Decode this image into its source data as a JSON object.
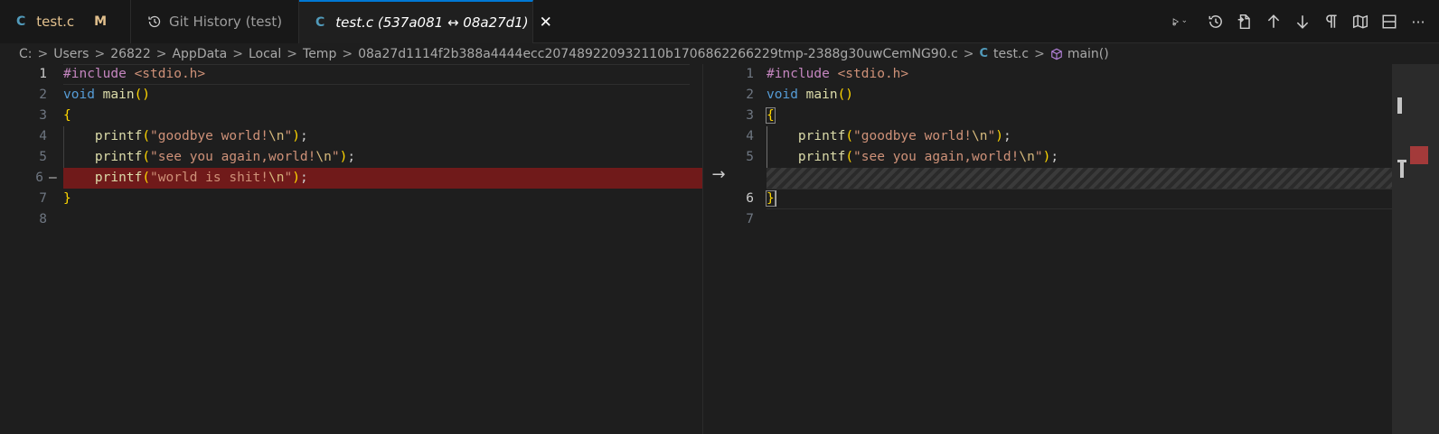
{
  "tabs": [
    {
      "icon": "C",
      "label": "test.c",
      "status": "M"
    },
    {
      "label": "Git History (test)"
    },
    {
      "icon": "C",
      "label": "test.c (537a081 ↔ 08a27d1)",
      "close": "✕"
    }
  ],
  "toolbar": {
    "icons": [
      "run-debug-icon",
      "chevron-down-icon",
      "history-icon",
      "open-file-icon",
      "arrow-up-icon",
      "arrow-down-icon",
      "pilcrow-icon",
      "book-icon",
      "split-editor-icon",
      "more-icon"
    ],
    "more": "···"
  },
  "breadcrumb": {
    "items": [
      "C:",
      "Users",
      "26822",
      "AppData",
      "Local",
      "Temp",
      "08a27d1114f2b388a4444ecc207489220932110b1706862266229tmp-2388g30uwCemNG90.c"
    ],
    "file_icon": "C",
    "file": "test.c",
    "symbol": "main()",
    "separator": ">"
  },
  "left_editor": {
    "line_numbers": [
      "1",
      "2",
      "3",
      "4",
      "5",
      "6",
      "7",
      "8"
    ],
    "removed_marker": "—",
    "lines": [
      {
        "a": "#include",
        "b": " <stdio.h>"
      },
      {
        "a": "void",
        "b": " main",
        "c": "()"
      },
      {
        "a": "{"
      },
      {
        "a": "    printf",
        "b": "(",
        "c": "\"goodbye world!",
        "d": "\\n",
        "e": "\"",
        "f": ")",
        "g": ";"
      },
      {
        "a": "    printf",
        "b": "(",
        "c": "\"see you again,world!",
        "d": "\\n",
        "e": "\"",
        "f": ")",
        "g": ";"
      },
      {
        "a": "    printf",
        "b": "(",
        "c": "\"world is shit!",
        "d": "\\n",
        "e": "\"",
        "f": ")",
        "g": ";"
      },
      {
        "a": "}"
      }
    ]
  },
  "right_editor": {
    "line_numbers": [
      "1",
      "2",
      "3",
      "4",
      "5",
      "6",
      "7"
    ],
    "lines": [
      {
        "a": "#include",
        "b": " <stdio.h>"
      },
      {
        "a": "void",
        "b": " main",
        "c": "()"
      },
      {
        "a": "{"
      },
      {
        "a": "    printf",
        "b": "(",
        "c": "\"goodbye world!",
        "d": "\\n",
        "e": "\"",
        "f": ")",
        "g": ";"
      },
      {
        "a": "    printf",
        "b": "(",
        "c": "\"see you again,world!",
        "d": "\\n",
        "e": "\"",
        "f": ")",
        "g": ";"
      },
      {
        "a": "}"
      }
    ]
  },
  "diff_arrow": "→",
  "colors": {
    "accent": "#0078d4",
    "removed_line": "#701a1a",
    "modified_badge": "#e2c08d",
    "c_icon": "#519aba"
  }
}
